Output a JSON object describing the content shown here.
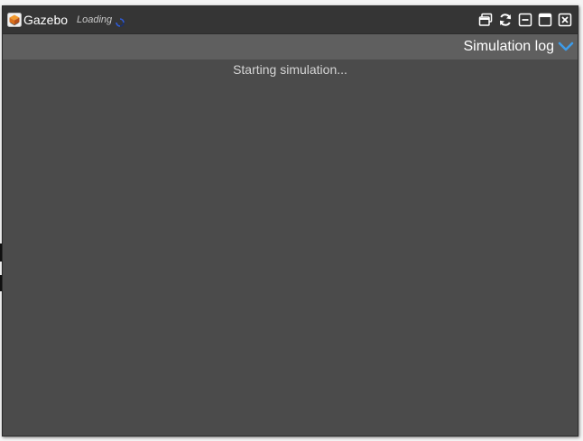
{
  "window": {
    "title": "Gazebo",
    "status": "Loading",
    "controls": [
      {
        "name": "restore-button",
        "icon": "restore-windows-icon"
      },
      {
        "name": "reload-button",
        "icon": "refresh-icon"
      },
      {
        "name": "minimize-button",
        "icon": "minimize-icon"
      },
      {
        "name": "maximize-button",
        "icon": "maximize-icon"
      },
      {
        "name": "close-button",
        "icon": "close-icon"
      }
    ]
  },
  "log_panel": {
    "title": "Simulation log",
    "toggle_icon": "chevron-down-icon",
    "messages": [
      "Starting simulation..."
    ]
  },
  "colors": {
    "titlebar": "#353535",
    "log_header": "#5f5f5f",
    "body": "#4b4b4b",
    "accent": "#3d9be9",
    "spinner": "#2e5bd8"
  }
}
